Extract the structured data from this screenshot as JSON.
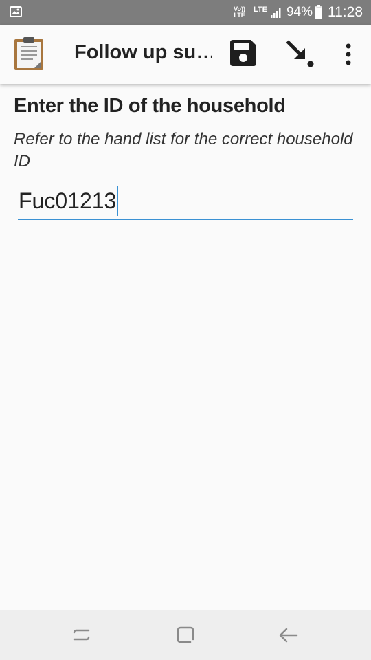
{
  "status_bar": {
    "network_label_top": "Vo))",
    "network_label_bottom": "LTE",
    "lte_label": "LTE",
    "battery_percent": "94%",
    "battery_level": 0.94,
    "time": "11:28"
  },
  "app_bar": {
    "title": "Follow up su…",
    "icons": [
      "clipboard-icon",
      "save-icon",
      "jump-to-icon",
      "more-vert-icon"
    ]
  },
  "question": {
    "label": "Enter the ID of the household",
    "hint": "Refer to the hand list for the correct household ID",
    "answer_value": "Fuc01213"
  },
  "nav_bar": {
    "icons": [
      "recent-apps-icon",
      "home-icon",
      "back-icon"
    ]
  },
  "colors": {
    "status_bar_bg": "#7d7d7d",
    "accent": "#3a91d3",
    "background": "#fafafa",
    "nav_bar_bg": "#eeeeee"
  }
}
